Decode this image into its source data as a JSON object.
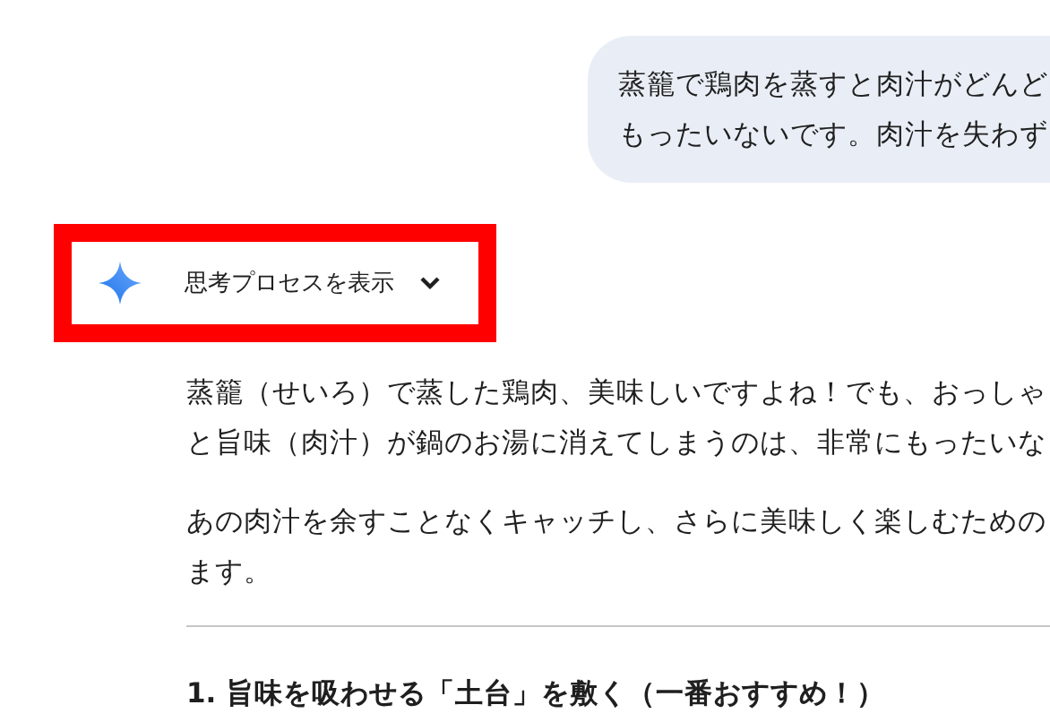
{
  "user_message": {
    "lines": [
      "蒸籠で鶏肉を蒸すと肉汁がどんど",
      "もったいないです。肉汁を失わず"
    ]
  },
  "thinking_toggle": {
    "label": "思考プロセスを表示",
    "expanded": false,
    "highlighted": true
  },
  "response": {
    "paragraphs": [
      [
        "蒸籠（せいろ）で蒸した鶏肉、美味しいですよね！でも、おっしゃ",
        "と旨味（肉汁）が鍋のお湯に消えてしまうのは、非常にもったいな"
      ],
      [
        "あの肉汁を余すことなくキャッチし、さらに美味しく楽しむための",
        "ます。"
      ]
    ],
    "heading": "1. 旨味を吸わせる「土台」を敷く（一番おすすめ！）"
  }
}
